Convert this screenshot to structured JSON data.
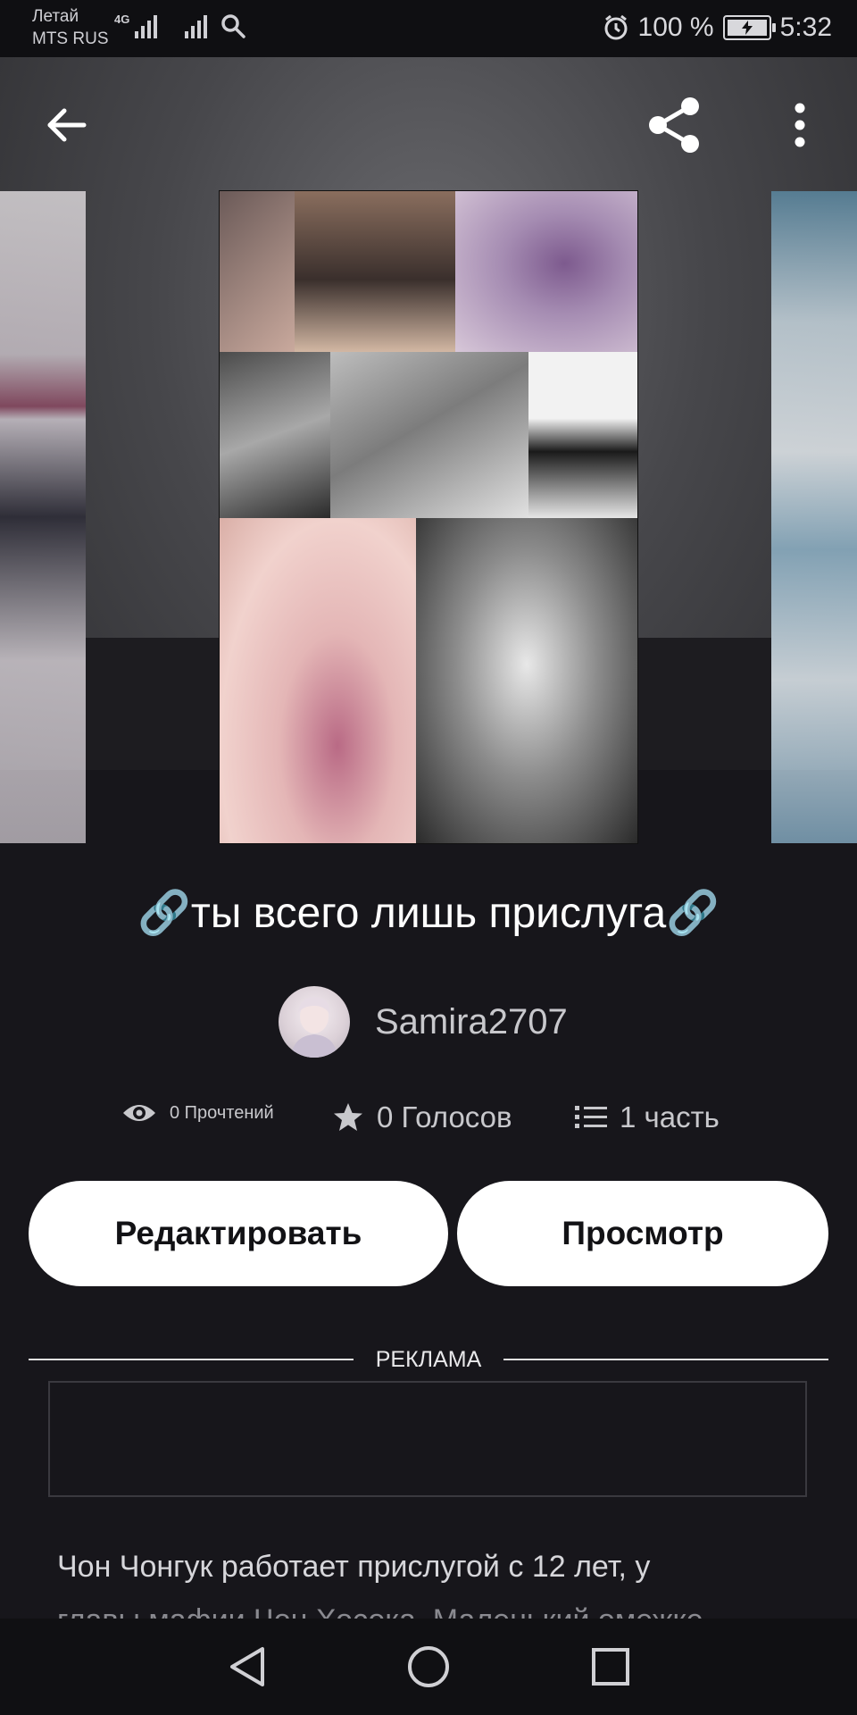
{
  "status_bar": {
    "carrier1": "Летай",
    "carrier2": "MTS RUS",
    "network": "4G",
    "battery_text": "100 %",
    "battery_level": 1.0,
    "time": "5:32"
  },
  "hero": {
    "back_icon": "arrow-left-icon",
    "share_icon": "share-icon",
    "more_icon": "more-vertical-icon"
  },
  "story": {
    "title": "🔗ты всего лишь прислуга🔗",
    "author": "Samira2707",
    "reads": "0 Прочтений",
    "votes": "0 Голосов",
    "parts": "1 часть"
  },
  "buttons": {
    "edit": "Редактировать",
    "preview": "Просмотр"
  },
  "ad": {
    "label": "РЕКЛАМА"
  },
  "description": {
    "line1": "Чон Чонгук работает прислугой с 12 лет, у",
    "line2": "главы мафии Чон Хосока. Маленький омежке"
  },
  "colors": {
    "background": "#17161b",
    "button_bg": "#ffffff",
    "text_muted": "#c8c8cc"
  }
}
